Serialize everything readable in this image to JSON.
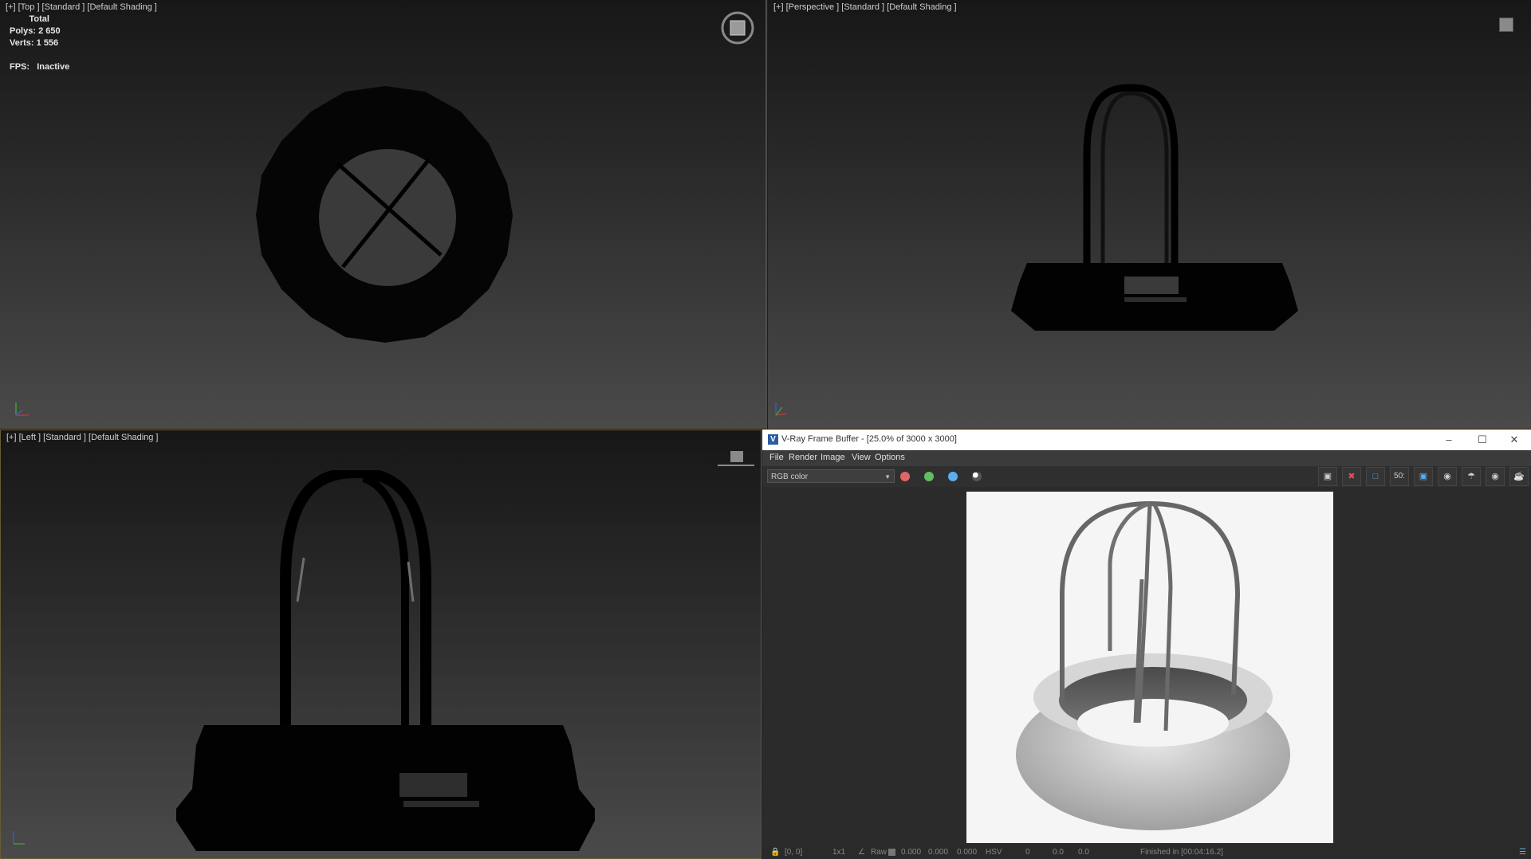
{
  "viewports": {
    "top": {
      "label": "[+] [Top ] [Standard ] [Default Shading ]"
    },
    "perspective": {
      "label": "[+] [Perspective ] [Standard ] [Default Shading ]"
    },
    "left": {
      "label": "[+] [Left ] [Standard ] [Default Shading ]"
    }
  },
  "stats": {
    "total_label": "Total",
    "polys_label": "Polys:",
    "polys_value": "2 650",
    "verts_label": "Verts:",
    "verts_value": "1 556",
    "fps_label": "FPS:",
    "fps_value": "Inactive"
  },
  "vfb": {
    "title": "V-Ray Frame Buffer - [25.0% of 3000 x 3000]",
    "menu": [
      "File",
      "Render",
      "Image",
      "View",
      "Options"
    ],
    "channel": "RGB color",
    "colors": {
      "red": "#e06666",
      "green": "#5fbf5f",
      "blue": "#5aaef0"
    },
    "toolbar_zoom": "50:",
    "status": {
      "coords": "[0, 0]",
      "sample": "1x1",
      "raw_label": "Raw",
      "v1": "0.000",
      "v2": "0.000",
      "v3": "0.000",
      "mode": "HSV",
      "h": "0",
      "s": "0.0",
      "v": "0.0",
      "finished": "Finished in [00:04:16.2]"
    }
  }
}
